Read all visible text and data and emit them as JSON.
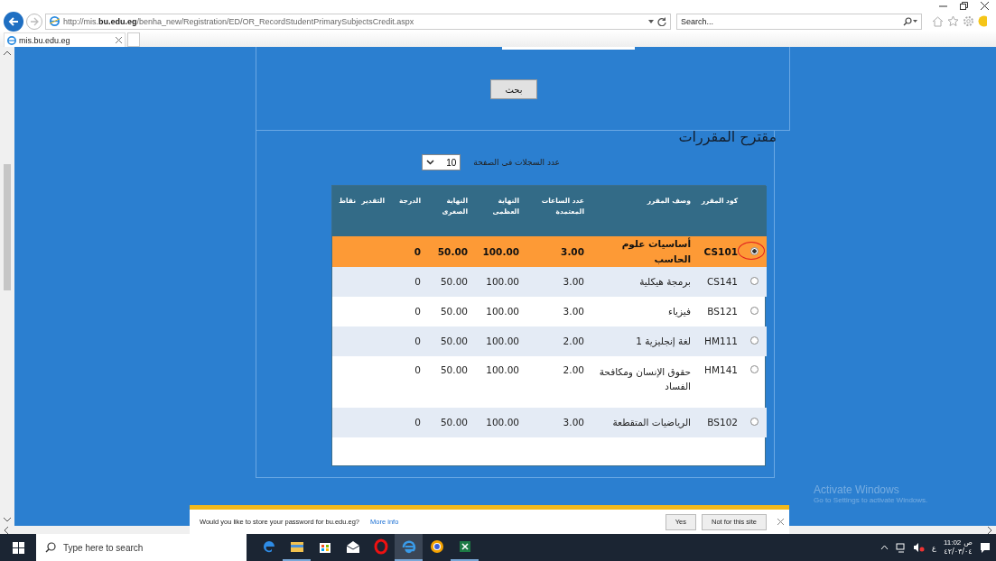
{
  "browser": {
    "url": "http://mis.**bu.edu.eg**/benha_new/Registration/ED/OR_RecordStudentPrimarySubjectsCredit.aspx",
    "search_placeholder": "Search...",
    "tab": {
      "title": "mis.bu.edu.eg",
      "selected": true
    }
  },
  "search_panel": {
    "button": "بحث"
  },
  "courses": {
    "title": "مقترح المقررات",
    "page_size_label": "عدد السجلات فى الصفحة",
    "page_size": "10",
    "columns": [
      "كود المقرر",
      "وصف المقرر",
      "عدد الساعات المعتمدة",
      "النهاية العظمى",
      "النهاية الصغرى",
      "الدرجة",
      "التقدير",
      "نقاط"
    ],
    "rows": [
      {
        "selected": true,
        "code": "CS101",
        "description": "أساسيات علوم الحاسب",
        "hours": "3.00",
        "max": "100.00",
        "min": "50.00",
        "grade": "0"
      },
      {
        "selected": false,
        "code": "CS141",
        "description": "برمجة هيكلية",
        "hours": "3.00",
        "max": "100.00",
        "min": "50.00",
        "grade": "0"
      },
      {
        "selected": false,
        "code": "BS121",
        "description": "فيزياء",
        "hours": "3.00",
        "max": "100.00",
        "min": "50.00",
        "grade": "0"
      },
      {
        "selected": false,
        "code": "HM111",
        "description": "لغة إنجليزية 1",
        "hours": "2.00",
        "max": "100.00",
        "min": "50.00",
        "grade": "0"
      },
      {
        "selected": false,
        "code": "HM141",
        "description": "حقوق الإنسان ومكافحة الفساد",
        "hours": "2.00",
        "max": "100.00",
        "min": "50.00",
        "grade": "0"
      },
      {
        "selected": false,
        "code": "BS102",
        "description": "الرياضيات المتقطعة",
        "hours": "3.00",
        "max": "100.00",
        "min": "50.00",
        "grade": "0"
      }
    ]
  },
  "os_notice": {
    "title": "Activate Windows",
    "subtitle": "Go to Settings to activate Windows."
  },
  "password_bar": {
    "message": "Would you like to store your password for bu.edu.eg?",
    "link": "More info",
    "accept_button": "Yes",
    "decline_button": "Not for this site"
  },
  "taskbar": {
    "search_placeholder": "Type here to search",
    "language": "ع",
    "time": "11:02",
    "period": "ص",
    "date": "٤٢/٠٣/٠٤"
  }
}
